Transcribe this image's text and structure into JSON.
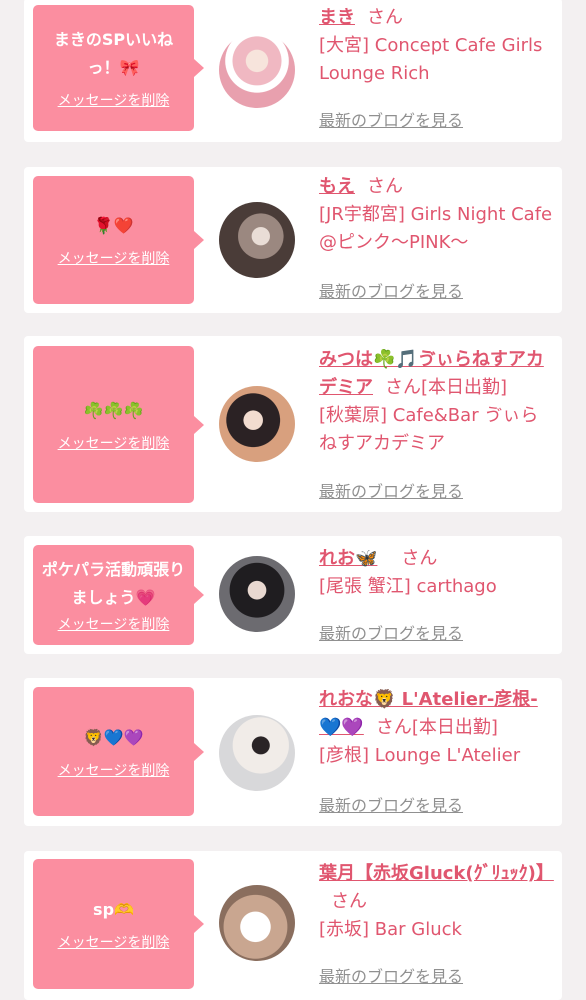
{
  "entries": [
    {
      "message": "まきのSPいいね\nっ！🎀",
      "delete_label": "メッセージを削除",
      "name": "まき",
      "san": "さん",
      "shop": "[大宮] Concept Cafe Girls Lounge Rich",
      "blog_label": "最新のブログを見る",
      "avatar_color": "#f2c8cf"
    },
    {
      "message": "🌹❤️",
      "delete_label": "メッセージを削除",
      "name": "もえ",
      "san": "さん",
      "shop": "[JR宇都宮] Girls Night Cafe @ピンク〜PINK〜",
      "blog_label": "最新のブログを見る",
      "avatar_color": "#5a4a45"
    },
    {
      "message": "☘️☘️☘️",
      "delete_label": "メッセージを削除",
      "name": "みつは☘️🎵ゔぃらねすアカデミア",
      "san": "さん[本日出勤]",
      "shop": "[秋葉原] Cafe&Bar ゔぃらねすアカデミア",
      "blog_label": "最新のブログを見る",
      "avatar_color": "#d9a58a"
    },
    {
      "message": "ポケパラ活動頑張りましょう💗",
      "delete_label": "メッセージを削除",
      "name": "れお🦋",
      "san": "さん",
      "shop": "[尾張 蟹江] carthago",
      "blog_label": "最新のブログを見る",
      "avatar_color": "#3c3c3e"
    },
    {
      "message": "🦁💙💜",
      "delete_label": "メッセージを削除",
      "name": "れおな🦁 L'Atelier-彦根-💙💜",
      "san": "さん[本日出勤]",
      "shop": "[彦根] Lounge L'Atelier",
      "blog_label": "最新のブログを見る",
      "avatar_color": "#e4e4e6"
    },
    {
      "message": "sp🫶",
      "delete_label": "メッセージを削除",
      "name": "葉月【赤坂Gluck(ｸﾞﾘｭｯｸ)】",
      "san": "さん",
      "shop": "[赤坂] Bar Gluck",
      "blog_label": "最新のブログを見る",
      "avatar_color": "#b59a85"
    }
  ]
}
